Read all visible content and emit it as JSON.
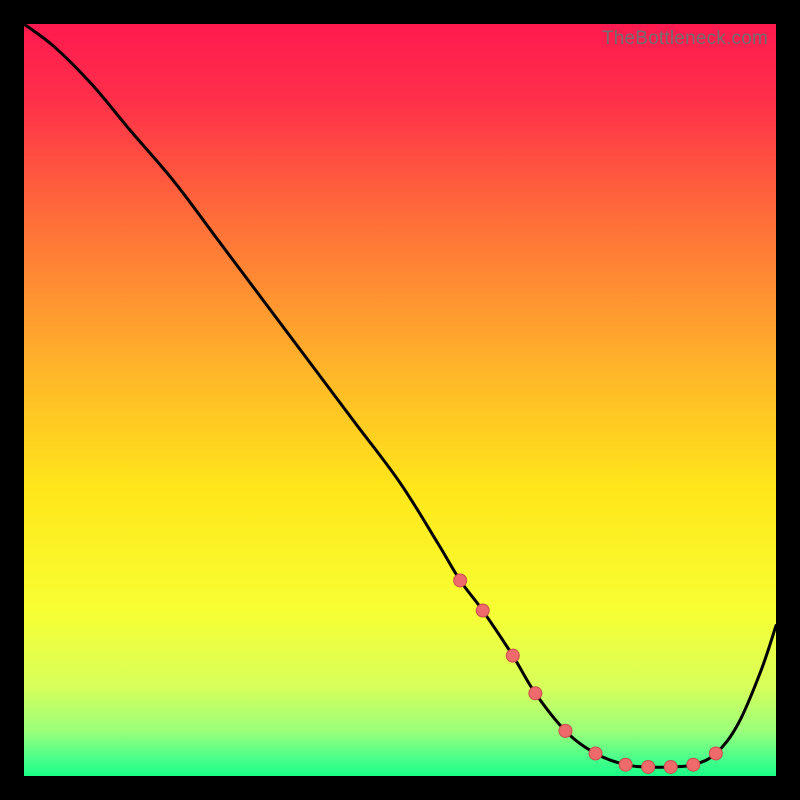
{
  "watermark": "TheBottleneck.com",
  "gradient": {
    "stops": [
      {
        "offset": 0.0,
        "color": "#ff1a4f"
      },
      {
        "offset": 0.1,
        "color": "#ff2f4a"
      },
      {
        "offset": 0.25,
        "color": "#ff6a3a"
      },
      {
        "offset": 0.45,
        "color": "#ffb22a"
      },
      {
        "offset": 0.62,
        "color": "#ffe71a"
      },
      {
        "offset": 0.78,
        "color": "#f7ff33"
      },
      {
        "offset": 0.88,
        "color": "#d8ff5a"
      },
      {
        "offset": 0.94,
        "color": "#9bff7a"
      },
      {
        "offset": 0.975,
        "color": "#4dff8a"
      },
      {
        "offset": 1.0,
        "color": "#1aff88"
      }
    ]
  },
  "chart_data": {
    "type": "line",
    "title": "",
    "xlabel": "",
    "ylabel": "",
    "xlim": [
      0,
      100
    ],
    "ylim": [
      0,
      100
    ],
    "series": [
      {
        "name": "bottleneck-curve",
        "x": [
          0,
          4,
          9,
          14,
          20,
          26,
          32,
          38,
          44,
          50,
          55,
          58,
          61,
          65,
          68,
          72,
          76,
          80,
          83,
          86,
          89,
          92,
          95,
          98,
          100
        ],
        "values": [
          100,
          97,
          92,
          86,
          79,
          71,
          63,
          55,
          47,
          39,
          31,
          26,
          22,
          16,
          11,
          6,
          3,
          1.5,
          1.2,
          1.2,
          1.5,
          3,
          7,
          14,
          20
        ]
      }
    ],
    "markers": {
      "name": "highlight-points",
      "x": [
        58,
        61,
        65,
        68,
        72,
        76,
        80,
        83,
        86,
        89,
        92
      ],
      "values": [
        26,
        22,
        16,
        11,
        6,
        3,
        1.5,
        1.2,
        1.2,
        1.5,
        3
      ]
    }
  }
}
